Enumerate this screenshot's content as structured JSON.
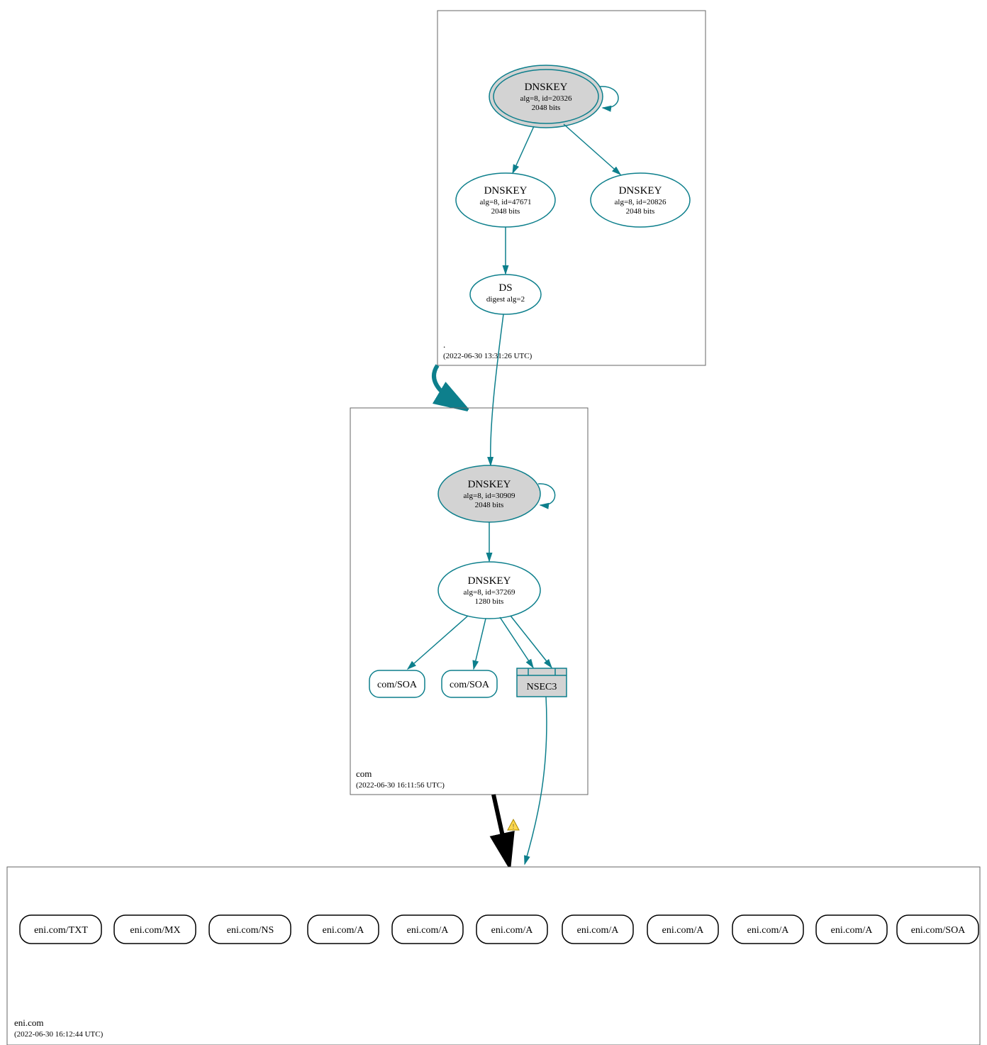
{
  "zones": {
    "root": {
      "name": ".",
      "time": "(2022-06-30 13:31:26 UTC)"
    },
    "com": {
      "name": "com",
      "time": "(2022-06-30 16:11:56 UTC)"
    },
    "eni": {
      "name": "eni.com",
      "time": "(2022-06-30 16:12:44 UTC)"
    }
  },
  "nodes": {
    "root_ksk": {
      "title": "DNSKEY",
      "sub1": "alg=8, id=20326",
      "sub2": "2048 bits"
    },
    "root_zsk1": {
      "title": "DNSKEY",
      "sub1": "alg=8, id=47671",
      "sub2": "2048 bits"
    },
    "root_zsk2": {
      "title": "DNSKEY",
      "sub1": "alg=8, id=20826",
      "sub2": "2048 bits"
    },
    "root_ds": {
      "title": "DS",
      "sub1": "digest alg=2"
    },
    "com_ksk": {
      "title": "DNSKEY",
      "sub1": "alg=8, id=30909",
      "sub2": "2048 bits"
    },
    "com_zsk": {
      "title": "DNSKEY",
      "sub1": "alg=8, id=37269",
      "sub2": "1280 bits"
    },
    "com_soa1": {
      "label": "com/SOA"
    },
    "com_soa2": {
      "label": "com/SOA"
    },
    "com_nsec3": {
      "label": "NSEC3"
    }
  },
  "eni_records": [
    "eni.com/TXT",
    "eni.com/MX",
    "eni.com/NS",
    "eni.com/A",
    "eni.com/A",
    "eni.com/A",
    "eni.com/A",
    "eni.com/A",
    "eni.com/A",
    "eni.com/A",
    "eni.com/SOA"
  ]
}
